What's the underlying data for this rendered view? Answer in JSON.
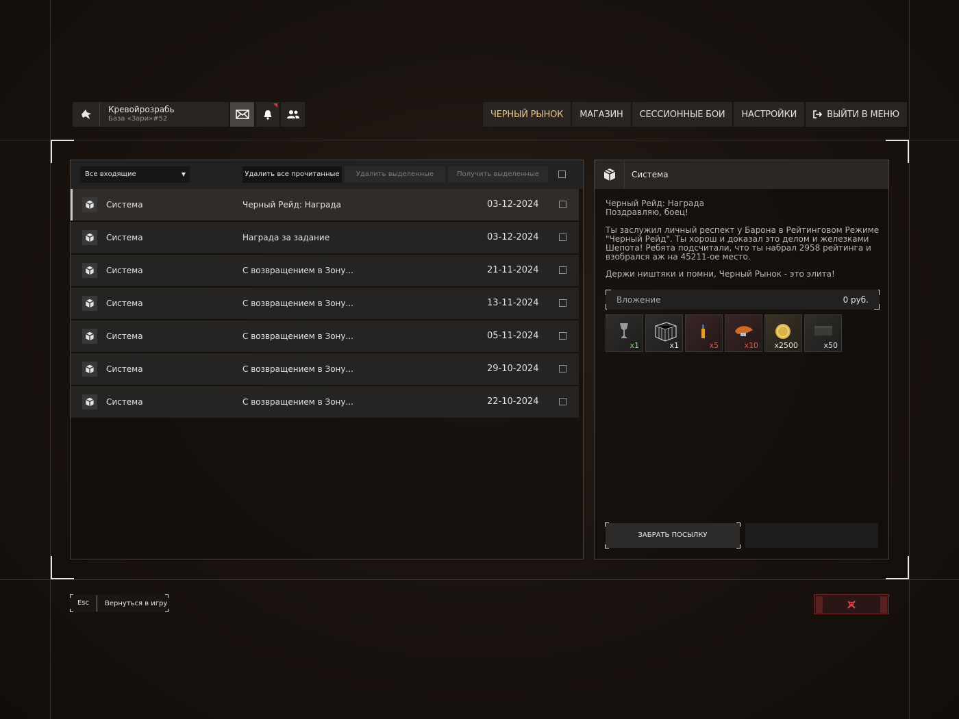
{
  "profile": {
    "name": "Кревойрозрабь",
    "base": "База «Зари»#52",
    "logo_icon": "wolf-head-icon"
  },
  "top_icons": [
    {
      "name": "mail-icon",
      "active": true
    },
    {
      "name": "bell-icon",
      "notification": true
    },
    {
      "name": "friends-icon"
    }
  ],
  "nav": {
    "black_market": "ЧЕРНЫЙ РЫНОК",
    "shop": "МАГАЗИН",
    "session_battles": "СЕССИОННЫЕ БОИ",
    "settings": "НАСТРОЙКИ",
    "exit": "ВЫЙТИ В МЕНЮ"
  },
  "mail": {
    "filter": "Все входящие",
    "delete_read": "Удалить все прочитанные",
    "delete_selected": "Удалить выделенные",
    "get_selected": "Получить выделенные",
    "messages": [
      {
        "sender": "Система",
        "subject": "Черный Рейд: Награда",
        "date": "03-12-2024"
      },
      {
        "sender": "Система",
        "subject": "Награда за задание",
        "date": "03-12-2024"
      },
      {
        "sender": "Система",
        "subject": "С возвращением в Зону...",
        "date": "21-11-2024"
      },
      {
        "sender": "Система",
        "subject": "С возвращением в Зону...",
        "date": "13-11-2024"
      },
      {
        "sender": "Система",
        "subject": "С возвращением в Зону...",
        "date": "05-11-2024"
      },
      {
        "sender": "Система",
        "subject": "С возвращением в Зону...",
        "date": "29-10-2024"
      },
      {
        "sender": "Система",
        "subject": "С возвращением в Зону...",
        "date": "22-10-2024"
      }
    ]
  },
  "detail": {
    "sender": "Система",
    "line1": "Черный Рейд: Награда",
    "line2": "Поздравляю, боец!",
    "body": "Ты заслужил личный респект у Барона в Рейтинговом Режиме \"Черный Рейд\". Ты хорош и доказал это делом и железками Шепота! Ребята подсчитали, что ты набрал 2958 рейтинга и взобрался аж на 45211-ое место.",
    "closing": "Держи ништяки и помни, Черный Рынок - это элита!",
    "attachment_label": "Вложение",
    "attachment_sum": "0 руб.",
    "items": [
      {
        "icon": "trophy-cup-icon",
        "count": "x1"
      },
      {
        "icon": "cage-crate-icon",
        "count": "x1"
      },
      {
        "icon": "syringe-icon",
        "count": "x5"
      },
      {
        "icon": "mushroom-icon",
        "count": "x10"
      },
      {
        "icon": "gold-coin-icon",
        "count": "x2500"
      },
      {
        "icon": "ammo-box-icon",
        "count": "x50"
      }
    ],
    "take_button": "ЗАБРАТЬ ПОСЫЛКУ"
  },
  "footer": {
    "esc_key": "Esc",
    "back_label": "Вернуться в игру",
    "danger_icon": "skull-crossbones-icon"
  }
}
